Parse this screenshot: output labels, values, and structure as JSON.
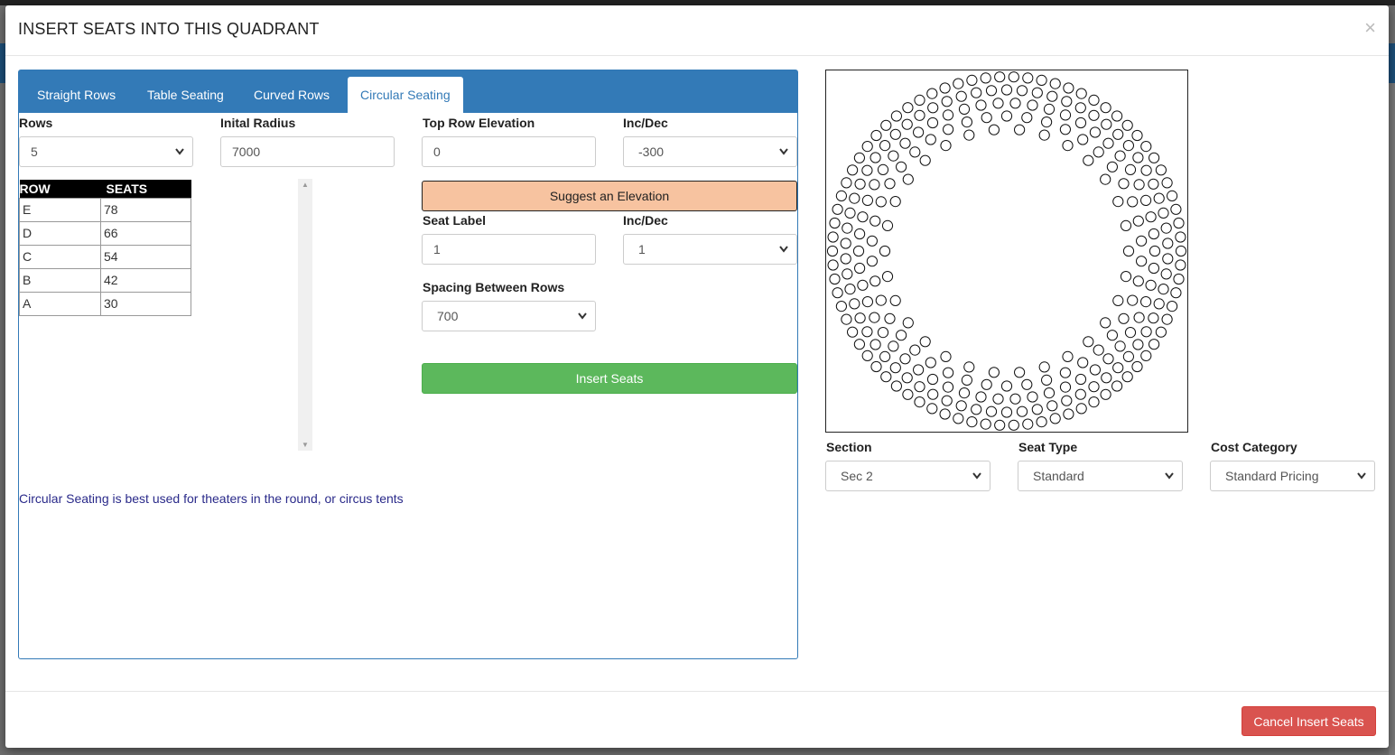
{
  "modal": {
    "title": "INSERT SEATS INTO THIS QUADRANT",
    "close_label": "×",
    "cancel_label": "Cancel Insert Seats"
  },
  "tabs": [
    {
      "label": "Straight Rows",
      "active": false
    },
    {
      "label": "Table Seating",
      "active": false
    },
    {
      "label": "Curved Rows",
      "active": false
    },
    {
      "label": "Circular Seating",
      "active": true
    }
  ],
  "form": {
    "rows_label": "Rows",
    "rows_value": "5",
    "radius_label": "Inital Radius",
    "radius_value": "7000",
    "top_elev_label": "Top Row Elevation",
    "top_elev_value": "0",
    "incdec1_label": "Inc/Dec",
    "incdec1_value": "-300",
    "suggest_label": "Suggest an Elevation",
    "seat_label_label": "Seat Label",
    "seat_label_value": "1",
    "incdec2_label": "Inc/Dec",
    "incdec2_value": "1",
    "spacing_label": "Spacing Between Rows",
    "spacing_value": "700",
    "insert_label": "Insert Seats"
  },
  "seat_table": {
    "headers": [
      "ROW",
      "SEATS"
    ],
    "rows": [
      {
        "row": "E",
        "seats": "78"
      },
      {
        "row": "D",
        "seats": "66"
      },
      {
        "row": "C",
        "seats": "54"
      },
      {
        "row": "B",
        "seats": "42"
      },
      {
        "row": "A",
        "seats": "30"
      }
    ]
  },
  "note": "Circular Seating is best used for theaters in the round, or circus tents",
  "bottom_selects": {
    "section_label": "Section",
    "section_value": "Sec 2",
    "seat_type_label": "Seat Type",
    "seat_type_value": "Standard",
    "cost_label": "Cost Category",
    "cost_value": "Standard Pricing"
  },
  "colors": {
    "primary": "#337ab7",
    "suggest": "#f7c3a0",
    "insert": "#5cb85c",
    "cancel": "#d9534f"
  }
}
